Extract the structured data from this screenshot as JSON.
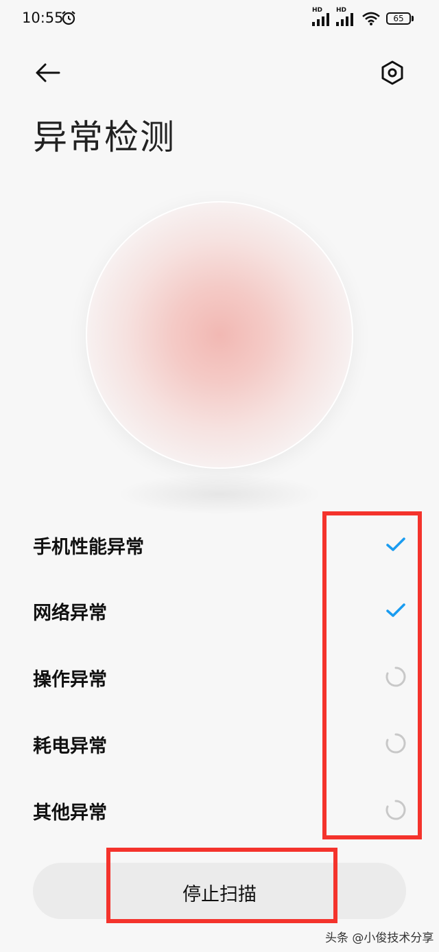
{
  "status_bar": {
    "time": "10:55",
    "sim1_label": "HD",
    "sim2_label": "HD",
    "battery": "65",
    "icons": [
      "alarm-icon",
      "signal-icon",
      "wifi-icon",
      "battery-icon"
    ]
  },
  "header": {
    "back_icon": "arrow-left-icon",
    "settings_icon": "hexagon-gear-icon",
    "title": "异常检测"
  },
  "checks": [
    {
      "label": "手机性能异常",
      "status": "done"
    },
    {
      "label": "网络异常",
      "status": "done"
    },
    {
      "label": "操作异常",
      "status": "loading"
    },
    {
      "label": "耗电异常",
      "status": "loading"
    },
    {
      "label": "其他异常",
      "status": "loading"
    }
  ],
  "stop_button": {
    "label": "停止扫描"
  },
  "colors": {
    "check": "#1a9cf0",
    "spinner": "#c8c8c8",
    "highlight": "#f4332c",
    "orb_center": "#f2b8b3"
  },
  "watermark": "头条 @小俊技术分享"
}
